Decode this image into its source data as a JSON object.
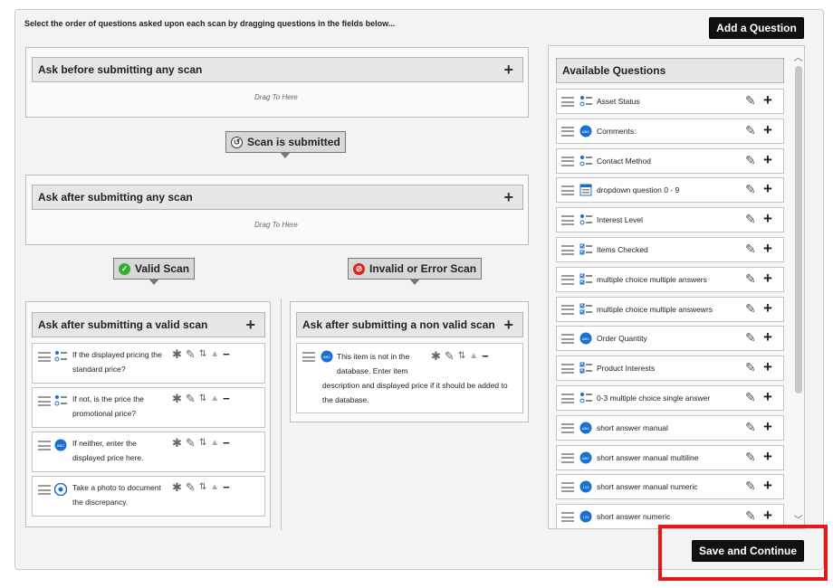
{
  "instructions": "Select the order of questions asked upon each scan by dragging questions in the fields below...",
  "buttons": {
    "add_question": "Add a Question",
    "save_continue": "Save and Continue"
  },
  "sections": {
    "before_submit": {
      "title": "Ask before submitting any scan",
      "hint": "Drag To Here"
    },
    "scan_submitted_label": "Scan is submitted",
    "after_any": {
      "title": "Ask after submitting any scan",
      "hint": "Drag To Here"
    },
    "valid_scan_label": "Valid Scan",
    "invalid_scan_label": "Invalid or Error Scan",
    "after_valid": {
      "title": "Ask after submitting a valid scan",
      "questions": [
        {
          "line1": "If the displayed pricing the",
          "line2": "standard price?",
          "type_icon": "list-icon"
        },
        {
          "line1": "If not, is the price the",
          "line2": "promotional price?",
          "type_icon": "list-icon"
        },
        {
          "line1": "If neither, enter the",
          "line2": "displayed price here.",
          "type_icon": "text-bubble-icon"
        },
        {
          "line1": "Take a photo to document",
          "line2": "the discrepancy.",
          "type_icon": "camera-icon"
        }
      ]
    },
    "after_invalid": {
      "title": "Ask after submitting a non valid scan",
      "questions": [
        {
          "line1": "This item is not in the",
          "line2": "database. Enter item",
          "line3": "description and displayed price if it should be added to",
          "line4": "the database.",
          "type_icon": "text-bubble-icon"
        }
      ]
    }
  },
  "available": {
    "title": "Available Questions",
    "items": [
      {
        "label": "Asset Status",
        "type_icon": "list-icon"
      },
      {
        "label": "Comments:",
        "type_icon": "text-bubble-icon"
      },
      {
        "label": "Contact Method",
        "type_icon": "list-icon"
      },
      {
        "label": "dropdown question 0 - 9",
        "type_icon": "dropdown-icon"
      },
      {
        "label": "Interest Level",
        "type_icon": "list-icon"
      },
      {
        "label": "Items Checked",
        "type_icon": "checkbox-icon"
      },
      {
        "label": "multiple choice multiple answers",
        "type_icon": "checkbox-icon"
      },
      {
        "label": "multiple choice multiple answewrs",
        "type_icon": "checkbox-icon"
      },
      {
        "label": "Order Quantity",
        "type_icon": "text-bubble-icon"
      },
      {
        "label": "Product Interests",
        "type_icon": "checkbox-icon"
      },
      {
        "label": "0-3 multiple choice single answer",
        "type_icon": "list-icon"
      },
      {
        "label": "short answer manual",
        "type_icon": "text-bubble-icon"
      },
      {
        "label": "short answer manual multiline",
        "type_icon": "text-bubble-icon"
      },
      {
        "label": "short answer manual numeric",
        "type_icon": "numeric-bubble-icon"
      },
      {
        "label": "short answer numeric",
        "type_icon": "numeric-bubble-icon"
      }
    ]
  },
  "colors": {
    "valid_green": "#2fae2f",
    "invalid_red": "#d9261c",
    "bubble_blue": "#1a6fd1",
    "highlight_red": "#e21a1a"
  }
}
